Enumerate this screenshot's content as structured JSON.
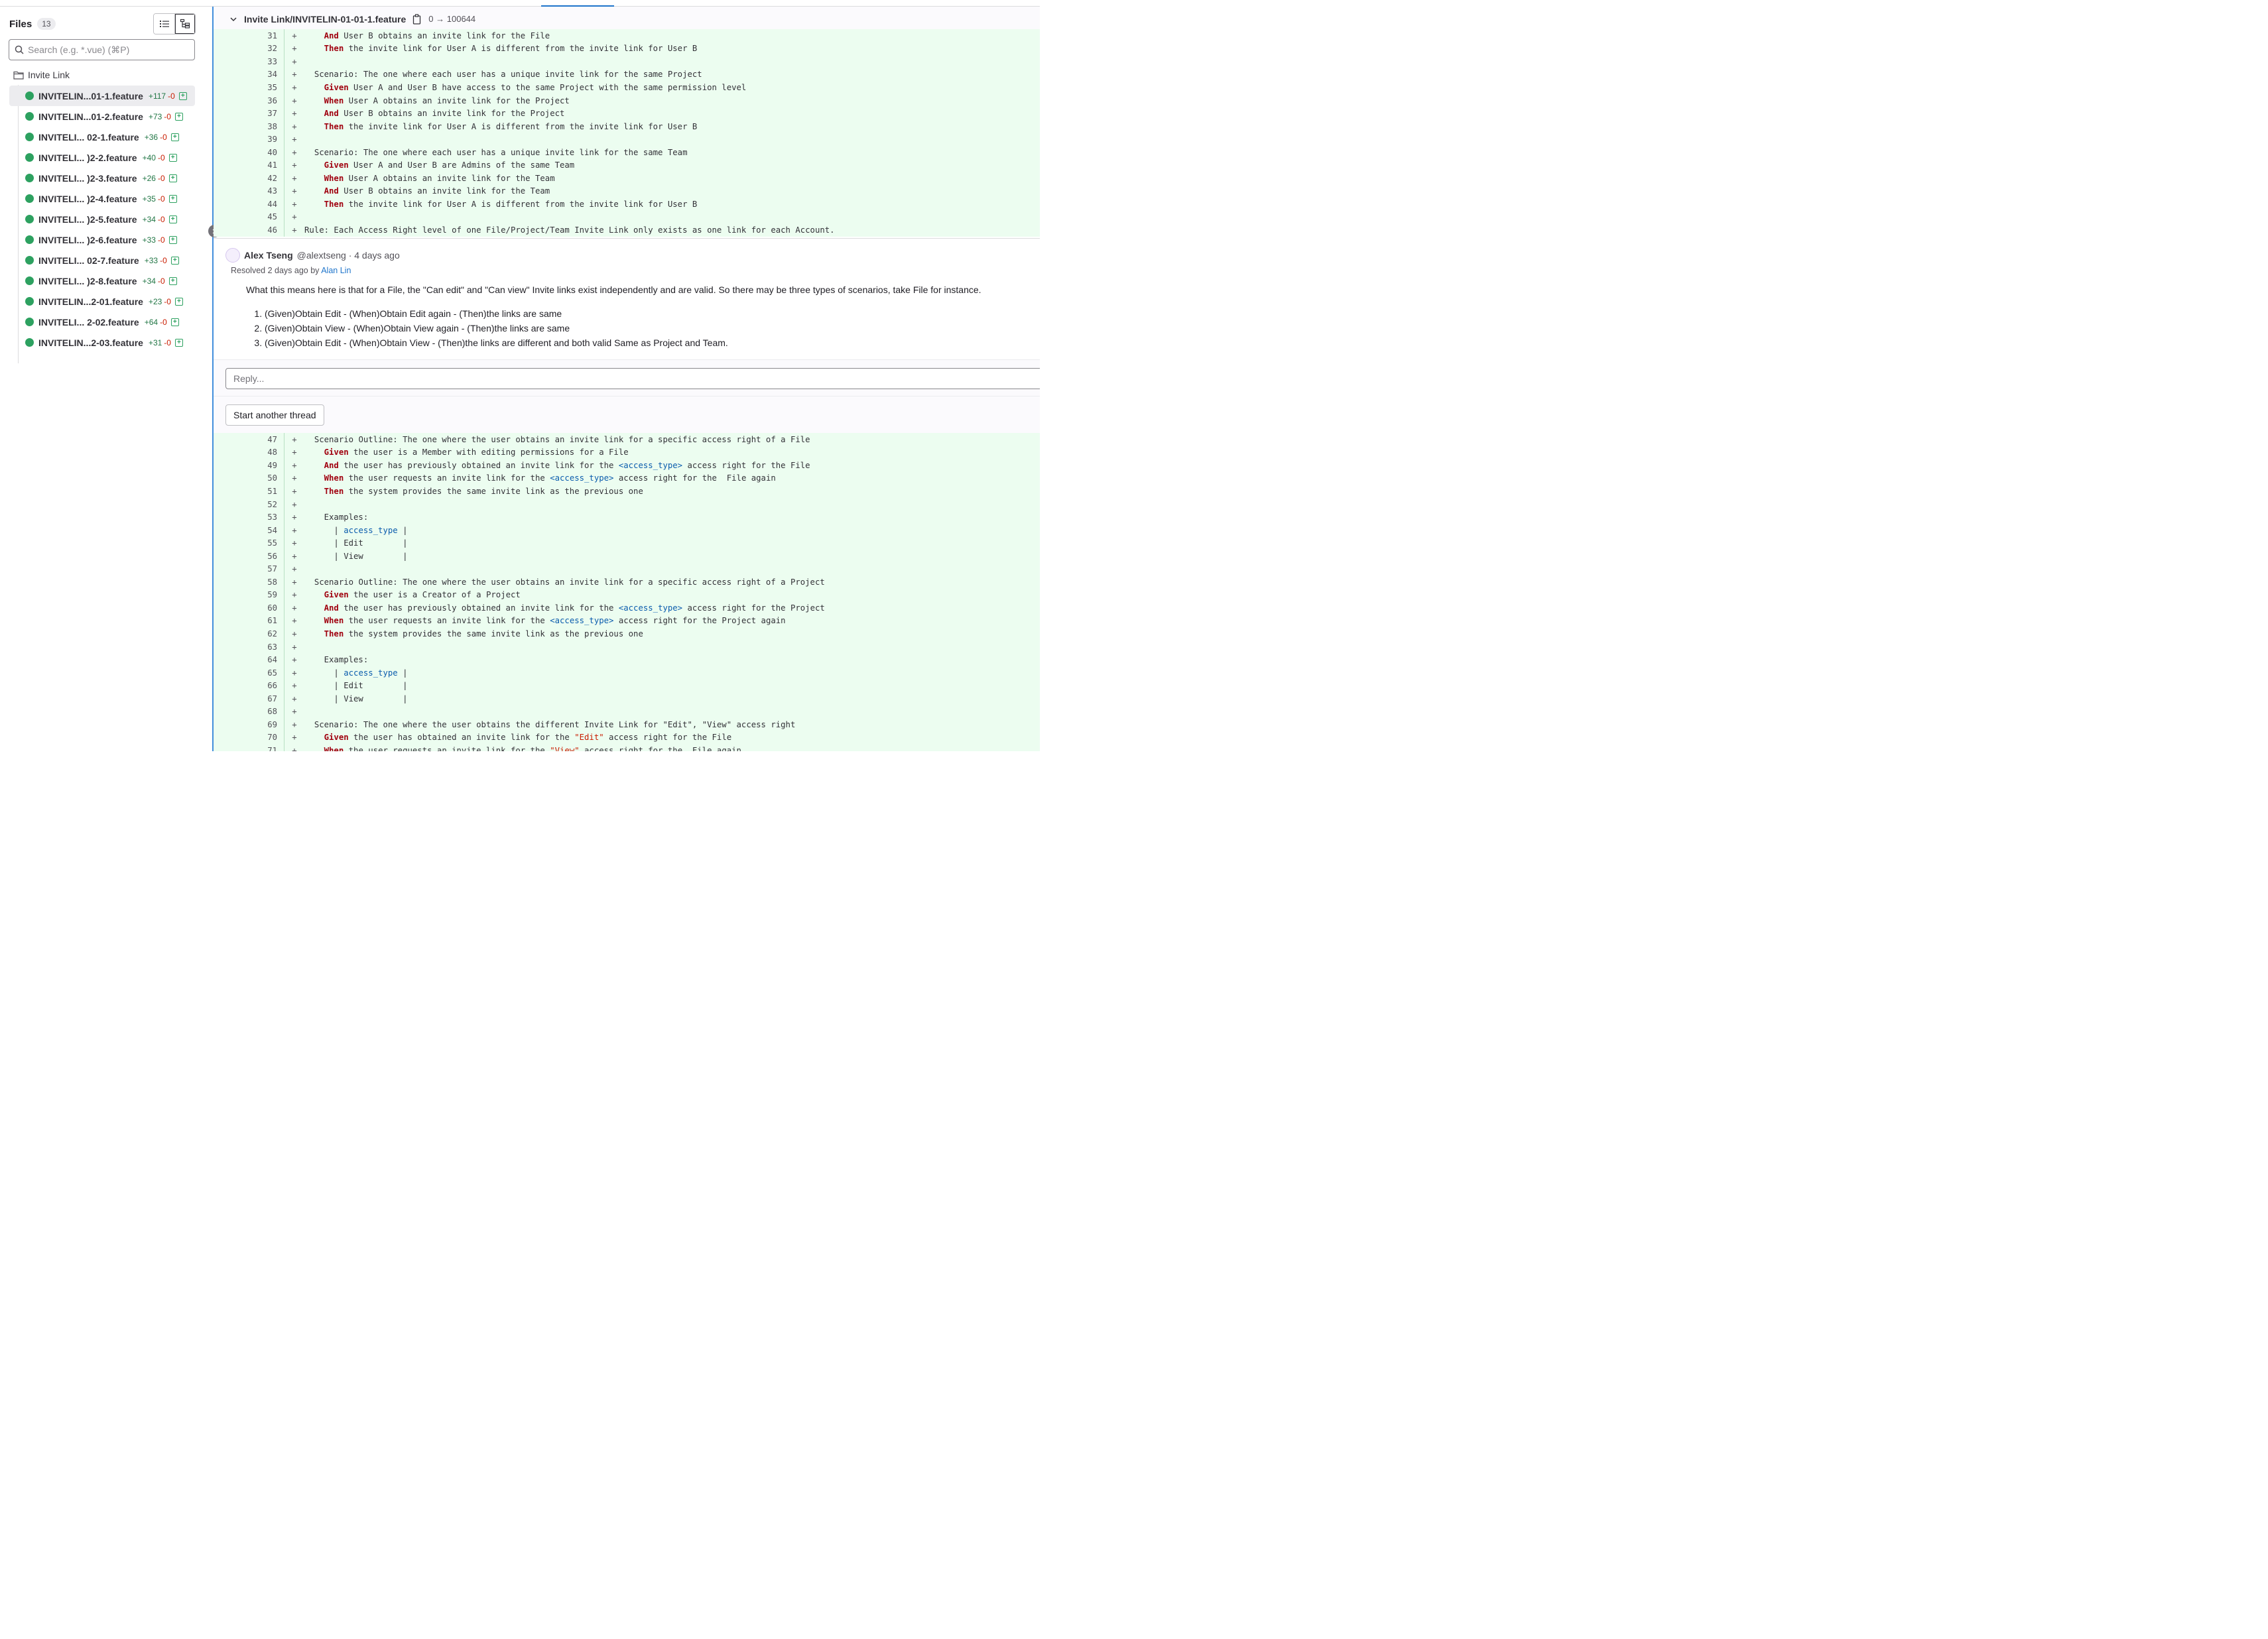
{
  "sidebar": {
    "title": "Files",
    "count": "13",
    "search_placeholder": "Search (e.g. *.vue) (⌘P)",
    "folder": "Invite Link",
    "files": [
      {
        "name": "INVITELIN...01-1.feature",
        "added": "+117",
        "removed": "-0"
      },
      {
        "name": "INVITELIN...01-2.feature",
        "added": "+73",
        "removed": "-0"
      },
      {
        "name": "INVITELI... 02-1.feature",
        "added": "+36",
        "removed": "-0"
      },
      {
        "name": "INVITELI... )2-2.feature",
        "added": "+40",
        "removed": "-0"
      },
      {
        "name": "INVITELI... )2-3.feature",
        "added": "+26",
        "removed": "-0"
      },
      {
        "name": "INVITELI... )2-4.feature",
        "added": "+35",
        "removed": "-0"
      },
      {
        "name": "INVITELI... )2-5.feature",
        "added": "+34",
        "removed": "-0"
      },
      {
        "name": "INVITELI... )2-6.feature",
        "added": "+33",
        "removed": "-0"
      },
      {
        "name": "INVITELI... 02-7.feature",
        "added": "+33",
        "removed": "-0"
      },
      {
        "name": "INVITELI... )2-8.feature",
        "added": "+34",
        "removed": "-0"
      },
      {
        "name": "INVITELIN...2-01.feature",
        "added": "+23",
        "removed": "-0"
      },
      {
        "name": "INVITELI... 2-02.feature",
        "added": "+64",
        "removed": "-0"
      },
      {
        "name": "INVITELIN...2-03.feature",
        "added": "+31",
        "removed": "-0"
      }
    ]
  },
  "diff": {
    "file_path": "Invite Link/INVITELIN-01-01-1.feature",
    "file_mode": "0 → 100644",
    "marker": "+",
    "block_top": [
      {
        "n": "31",
        "segs": [
          [
            "    ",
            ""
          ],
          [
            "And",
            "kw"
          ],
          [
            " User B obtains an invite link for the File",
            ""
          ]
        ]
      },
      {
        "n": "32",
        "segs": [
          [
            "    ",
            ""
          ],
          [
            "Then",
            "kw"
          ],
          [
            " the invite link for User A is different from the invite link for User B",
            ""
          ]
        ]
      },
      {
        "n": "33",
        "segs": []
      },
      {
        "n": "34",
        "segs": [
          [
            "  ",
            ""
          ],
          [
            "Scenario:",
            "hd"
          ],
          [
            " The one where each user has a unique invite link for the same Project",
            ""
          ]
        ]
      },
      {
        "n": "35",
        "segs": [
          [
            "    ",
            ""
          ],
          [
            "Given",
            "kw"
          ],
          [
            " User A and User B have access to the same Project with the same permission level",
            ""
          ]
        ]
      },
      {
        "n": "36",
        "segs": [
          [
            "    ",
            ""
          ],
          [
            "When",
            "kw"
          ],
          [
            " User A obtains an invite link for the Project",
            ""
          ]
        ]
      },
      {
        "n": "37",
        "segs": [
          [
            "    ",
            ""
          ],
          [
            "And",
            "kw"
          ],
          [
            " User B obtains an invite link for the Project",
            ""
          ]
        ]
      },
      {
        "n": "38",
        "segs": [
          [
            "    ",
            ""
          ],
          [
            "Then",
            "kw"
          ],
          [
            " the invite link for User A is different from the invite link for User B",
            ""
          ]
        ]
      },
      {
        "n": "39",
        "segs": []
      },
      {
        "n": "40",
        "segs": [
          [
            "  ",
            ""
          ],
          [
            "Scenario:",
            "hd"
          ],
          [
            " The one where each user has a unique invite link for the same Team",
            ""
          ]
        ]
      },
      {
        "n": "41",
        "segs": [
          [
            "    ",
            ""
          ],
          [
            "Given",
            "kw"
          ],
          [
            " User A and User B are Admins of the same Team",
            ""
          ]
        ]
      },
      {
        "n": "42",
        "segs": [
          [
            "    ",
            ""
          ],
          [
            "When",
            "kw"
          ],
          [
            " User A obtains an invite link for the Team",
            ""
          ]
        ]
      },
      {
        "n": "43",
        "segs": [
          [
            "    ",
            ""
          ],
          [
            "And",
            "kw"
          ],
          [
            " User B obtains an invite link for the Team",
            ""
          ]
        ]
      },
      {
        "n": "44",
        "segs": [
          [
            "    ",
            ""
          ],
          [
            "Then",
            "kw"
          ],
          [
            " the invite link for User A is different from the invite link for User B",
            ""
          ]
        ]
      },
      {
        "n": "45",
        "segs": []
      },
      {
        "n": "46",
        "segs": [
          [
            "Rule:",
            "hd"
          ],
          [
            " Each Access Right level of one File/Project/Team Invite Link only exists as one link for each Account.",
            ""
          ]
        ]
      }
    ],
    "block_bottom": [
      {
        "n": "47",
        "segs": [
          [
            "  ",
            ""
          ],
          [
            "Scenario Outline:",
            "hd"
          ],
          [
            " The one where the user obtains an invite link for a specific access right of a File",
            ""
          ]
        ]
      },
      {
        "n": "48",
        "segs": [
          [
            "    ",
            ""
          ],
          [
            "Given",
            "kw"
          ],
          [
            " the user is a Member with editing permissions for a File",
            ""
          ]
        ]
      },
      {
        "n": "49",
        "segs": [
          [
            "    ",
            ""
          ],
          [
            "And",
            "kw"
          ],
          [
            " the user has previously obtained an invite link for the ",
            ""
          ],
          [
            "<access_type>",
            "ph"
          ],
          [
            " access right for the File",
            ""
          ]
        ]
      },
      {
        "n": "50",
        "segs": [
          [
            "    ",
            ""
          ],
          [
            "When",
            "kw"
          ],
          [
            " the user requests an invite link for the ",
            ""
          ],
          [
            "<access_type>",
            "ph"
          ],
          [
            " access right for the  File again",
            ""
          ]
        ]
      },
      {
        "n": "51",
        "segs": [
          [
            "    ",
            ""
          ],
          [
            "Then",
            "kw"
          ],
          [
            " the system provides the same invite link as the previous one",
            ""
          ]
        ]
      },
      {
        "n": "52",
        "segs": []
      },
      {
        "n": "53",
        "segs": [
          [
            "    Examples:",
            ""
          ]
        ]
      },
      {
        "n": "54",
        "segs": [
          [
            "      | ",
            ""
          ],
          [
            "access_type",
            "ph"
          ],
          [
            " |",
            ""
          ]
        ]
      },
      {
        "n": "55",
        "segs": [
          [
            "      | Edit        |",
            ""
          ]
        ]
      },
      {
        "n": "56",
        "segs": [
          [
            "      | View        |",
            ""
          ]
        ]
      },
      {
        "n": "57",
        "segs": []
      },
      {
        "n": "58",
        "segs": [
          [
            "  ",
            ""
          ],
          [
            "Scenario Outline:",
            "hd"
          ],
          [
            " The one where the user obtains an invite link for a specific access right of a Project",
            ""
          ]
        ]
      },
      {
        "n": "59",
        "segs": [
          [
            "    ",
            ""
          ],
          [
            "Given",
            "kw"
          ],
          [
            " the user is a Creator of a Project",
            ""
          ]
        ]
      },
      {
        "n": "60",
        "segs": [
          [
            "    ",
            ""
          ],
          [
            "And",
            "kw"
          ],
          [
            " the user has previously obtained an invite link for the ",
            ""
          ],
          [
            "<access_type>",
            "ph"
          ],
          [
            " access right for the Project",
            ""
          ]
        ]
      },
      {
        "n": "61",
        "segs": [
          [
            "    ",
            ""
          ],
          [
            "When",
            "kw"
          ],
          [
            " the user requests an invite link for the ",
            ""
          ],
          [
            "<access_type>",
            "ph"
          ],
          [
            " access right for the Project again",
            ""
          ]
        ]
      },
      {
        "n": "62",
        "segs": [
          [
            "    ",
            ""
          ],
          [
            "Then",
            "kw"
          ],
          [
            " the system provides the same invite link as the previous one",
            ""
          ]
        ]
      },
      {
        "n": "63",
        "segs": []
      },
      {
        "n": "64",
        "segs": [
          [
            "    Examples:",
            ""
          ]
        ]
      },
      {
        "n": "65",
        "segs": [
          [
            "      | ",
            ""
          ],
          [
            "access_type",
            "ph"
          ],
          [
            " |",
            ""
          ]
        ]
      },
      {
        "n": "66",
        "segs": [
          [
            "      | Edit        |",
            ""
          ]
        ]
      },
      {
        "n": "67",
        "segs": [
          [
            "      | View        |",
            ""
          ]
        ]
      },
      {
        "n": "68",
        "segs": []
      },
      {
        "n": "69",
        "segs": [
          [
            "  ",
            ""
          ],
          [
            "Scenario:",
            "hd"
          ],
          [
            " The one where the user obtains the different Invite Link for \"Edit\", \"View\" access right",
            ""
          ]
        ]
      },
      {
        "n": "70",
        "segs": [
          [
            "    ",
            ""
          ],
          [
            "Given",
            "kw"
          ],
          [
            " the user has obtained an invite link for the ",
            ""
          ],
          [
            "\"Edit\"",
            "str"
          ],
          [
            " access right for the File",
            ""
          ]
        ]
      },
      {
        "n": "71",
        "segs": [
          [
            "    ",
            ""
          ],
          [
            "When",
            "kw"
          ],
          [
            " the user requests an invite link for the ",
            ""
          ],
          [
            "\"View\"",
            "str"
          ],
          [
            " access right for the  File again",
            ""
          ]
        ]
      }
    ]
  },
  "discussion": {
    "author": "Alex Tseng",
    "handle": "@alextseng · 4 days ago",
    "resolved_prefix": "Resolved 2 days ago by",
    "resolved_by": "Alan Lin",
    "body": "What this means here is that for a File, the \"Can edit\" and \"Can view\" Invite links exist independently and are valid. So there may be three types of scenarios, take File for instance.",
    "items": [
      "(Given)Obtain Edit - (When)Obtain Edit again - (Then)the links are same",
      "(Given)Obtain View - (When)Obtain View again - (Then)the links are same",
      "(Given)Obtain Edit - (When)Obtain View - (Then)the links are different and both valid Same as Project and Team."
    ],
    "reply_placeholder": "Reply...",
    "thread_button": "Start another thread"
  },
  "colors": {
    "added_bg": "#ecfdf0",
    "keyword": "#a0010f",
    "placeholder": "#0b5cad",
    "string": "#c91c00",
    "accent": "#428fdc",
    "add_count": "#217645",
    "del_count": "#c91c00",
    "file_icon": "#2da160"
  }
}
